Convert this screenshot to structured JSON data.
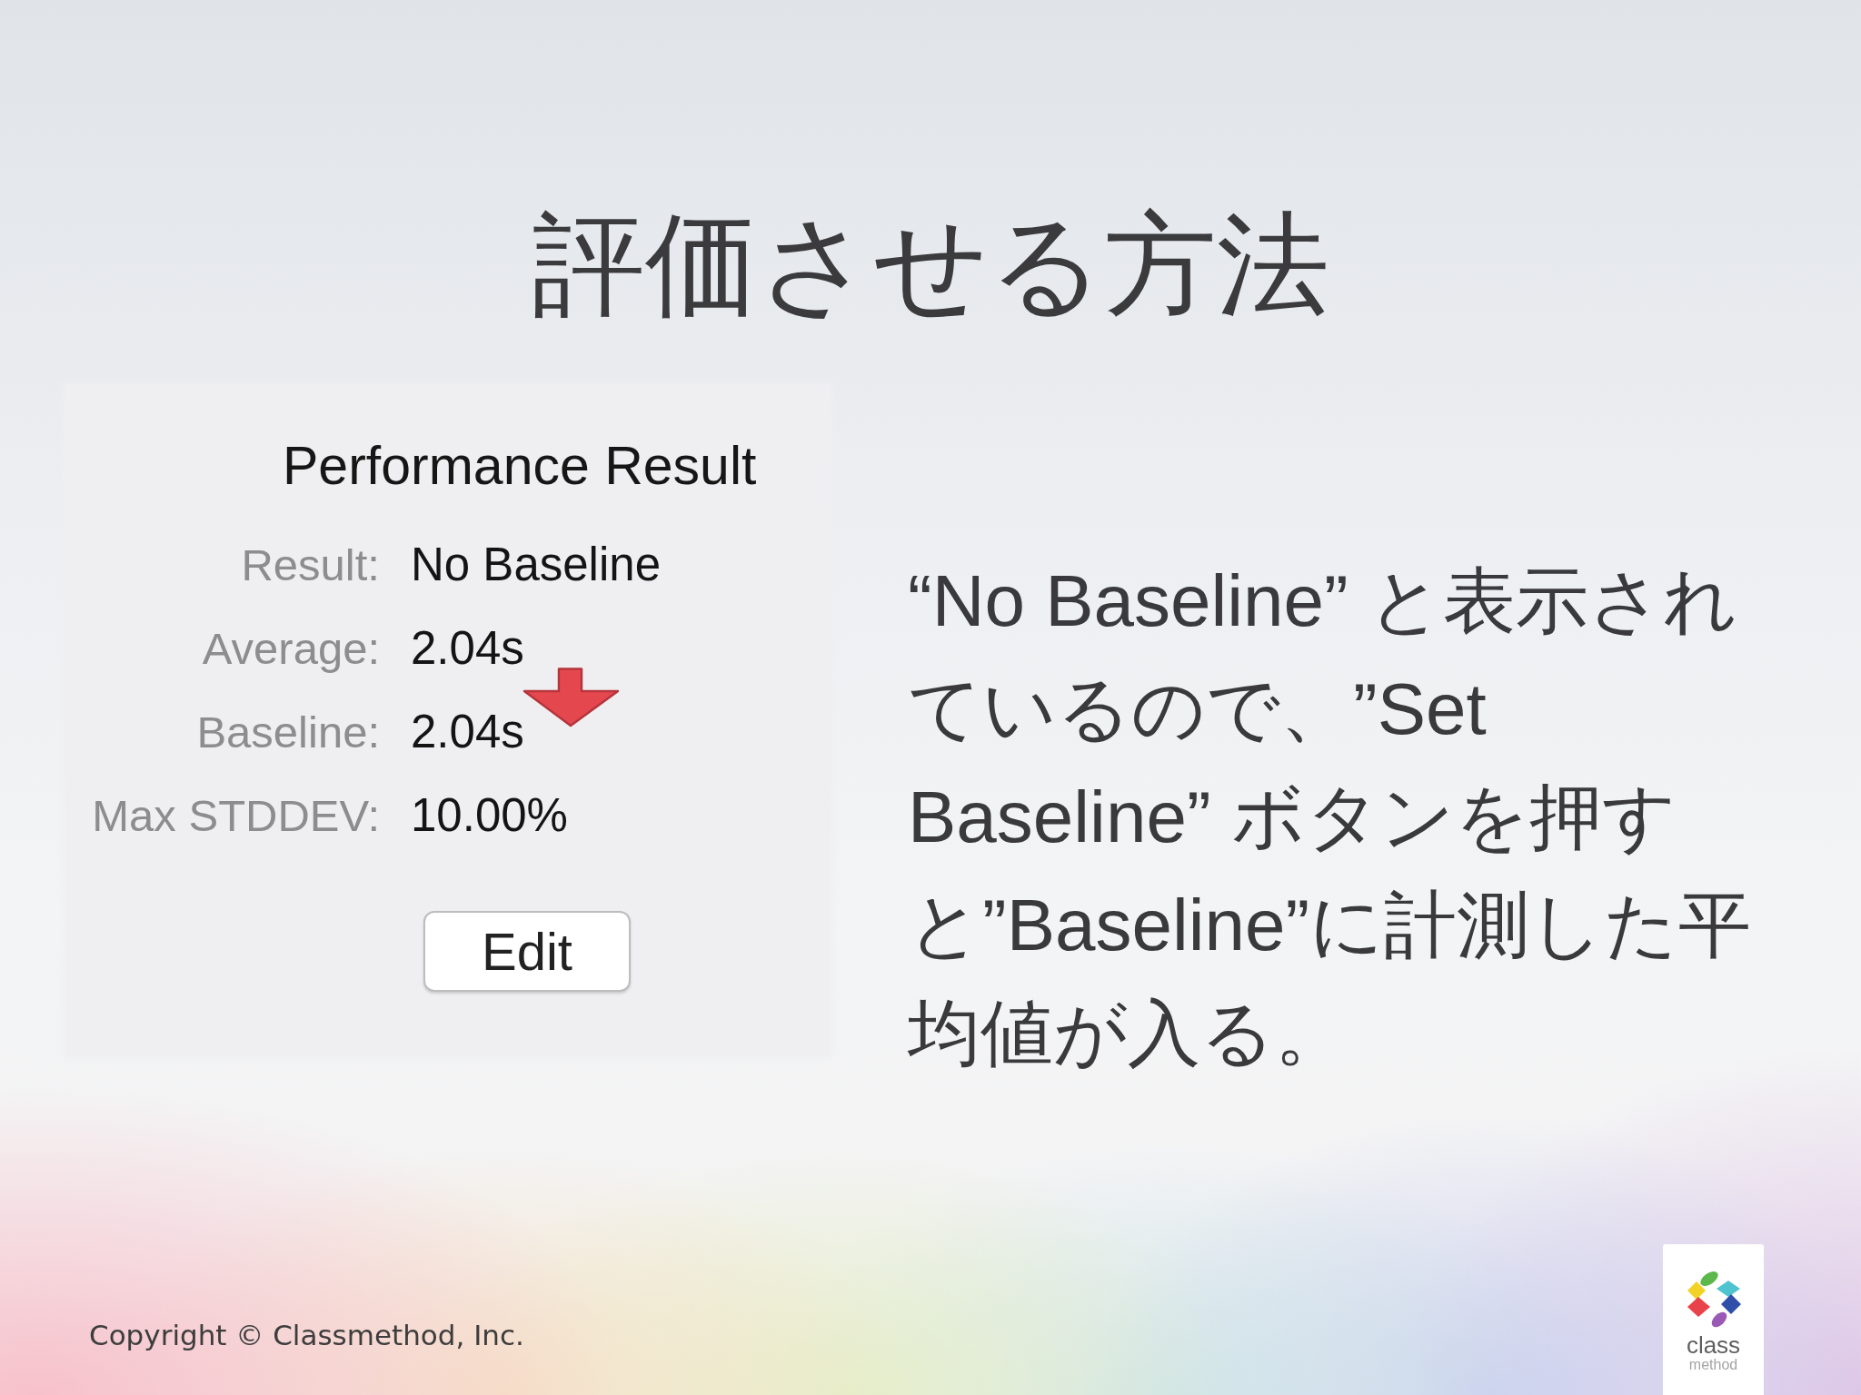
{
  "slide": {
    "title": "評価させる方法"
  },
  "screenshot": {
    "heading": "Performance Result",
    "rows": [
      {
        "label": "Result:",
        "value": "No Baseline"
      },
      {
        "label": "Average:",
        "value": "2.04s"
      },
      {
        "label": "Baseline:",
        "value": "2.04s"
      },
      {
        "label": "Max STDDEV:",
        "value": "10.00%"
      }
    ],
    "button": "Edit"
  },
  "body_text": "“No Baseline” と表示されているので、”Set Baseline” ボタンを押すと”Baseline”に計測した平均値が入る。",
  "footer": {
    "copyright": "Copyright © Classmethod, Inc."
  },
  "logo": {
    "wordmark": "class",
    "tagline": "method"
  }
}
